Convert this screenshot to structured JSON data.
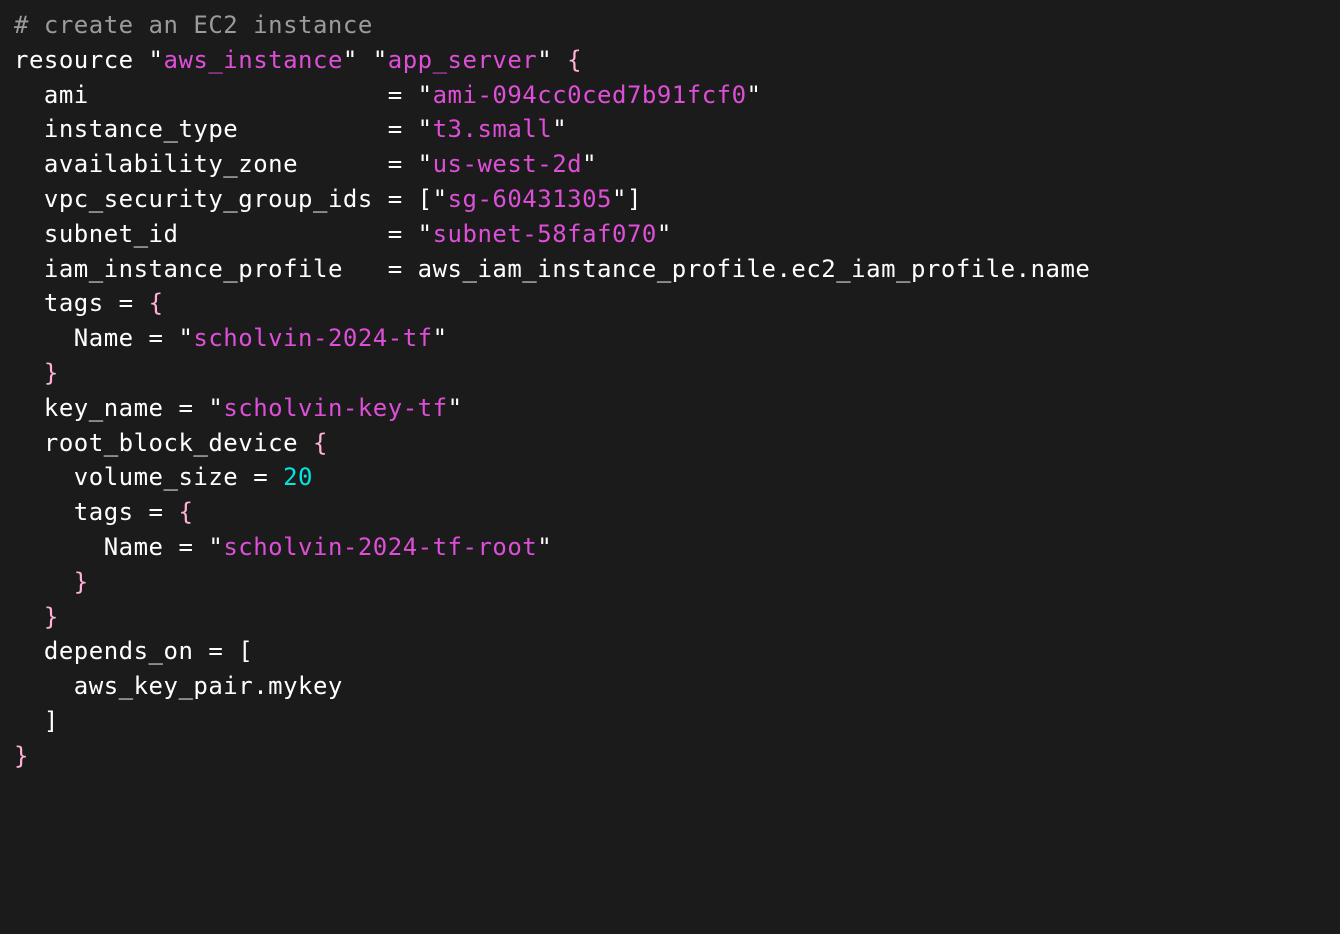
{
  "lines": {
    "l1": "# create an EC2 instance",
    "l2_kw": "resource",
    "l2_q1": "\"",
    "l2_type": "aws_instance",
    "l2_q2": "\"",
    "l2_sp": " ",
    "l2_q3": "\"",
    "l2_name": "app_server",
    "l2_q4": "\"",
    "l2_sp2": " ",
    "l2_ob": "{",
    "l3_pad": "  ",
    "l3_attr": "ami",
    "l3_pad2": "                    ",
    "l3_eq": "=",
    "l3_sp": " ",
    "l3_q1": "\"",
    "l3_val": "ami-094cc0ced7b91fcf0",
    "l3_q2": "\"",
    "l4_pad": "  ",
    "l4_attr": "instance_type",
    "l4_pad2": "          ",
    "l4_eq": "=",
    "l4_sp": " ",
    "l4_q1": "\"",
    "l4_val": "t3.small",
    "l4_q2": "\"",
    "l5_pad": "  ",
    "l5_attr": "availability_zone",
    "l5_pad2": "      ",
    "l5_eq": "=",
    "l5_sp": " ",
    "l5_q1": "\"",
    "l5_val": "us-west-2d",
    "l5_q2": "\"",
    "l6_pad": "  ",
    "l6_attr": "vpc_security_group_ids",
    "l6_pad2": " ",
    "l6_eq": "=",
    "l6_sp": " ",
    "l6_lb": "[",
    "l6_q1": "\"",
    "l6_val": "sg-60431305",
    "l6_q2": "\"",
    "l6_rb": "]",
    "l7_pad": "  ",
    "l7_attr": "subnet_id",
    "l7_pad2": "              ",
    "l7_eq": "=",
    "l7_sp": " ",
    "l7_q1": "\"",
    "l7_val": "subnet-58faf070",
    "l7_q2": "\"",
    "l8_pad": "  ",
    "l8_attr": "iam_instance_profile",
    "l8_pad2": "   ",
    "l8_eq": "=",
    "l8_sp": " ",
    "l8_val": "aws_iam_instance_profile.ec2_iam_profile.name",
    "l9_pad": "  ",
    "l9_attr": "tags",
    "l9_sp": " ",
    "l9_eq": "=",
    "l9_sp2": " ",
    "l9_ob": "{",
    "l10_pad": "    ",
    "l10_attr": "Name",
    "l10_sp": " ",
    "l10_eq": "=",
    "l10_sp2": " ",
    "l10_q1": "\"",
    "l10_val": "scholvin-2024-tf",
    "l10_q2": "\"",
    "l11_pad": "  ",
    "l11_cb": "}",
    "l12_pad": "  ",
    "l12_attr": "key_name",
    "l12_sp": " ",
    "l12_eq": "=",
    "l12_sp2": " ",
    "l12_q1": "\"",
    "l12_val": "scholvin-key-tf",
    "l12_q2": "\"",
    "l13_pad": "  ",
    "l13_attr": "root_block_device",
    "l13_sp": " ",
    "l13_ob": "{",
    "l14_pad": "    ",
    "l14_attr": "volume_size",
    "l14_sp": " ",
    "l14_eq": "=",
    "l14_sp2": " ",
    "l14_val": "20",
    "l15_pad": "    ",
    "l15_attr": "tags",
    "l15_sp": " ",
    "l15_eq": "=",
    "l15_sp2": " ",
    "l15_ob": "{",
    "l16_pad": "      ",
    "l16_attr": "Name",
    "l16_sp": " ",
    "l16_eq": "=",
    "l16_sp2": " ",
    "l16_q1": "\"",
    "l16_val": "scholvin-2024-tf-root",
    "l16_q2": "\"",
    "l17_pad": "    ",
    "l17_cb": "}",
    "l18_pad": "  ",
    "l18_cb": "}",
    "l19_pad": "  ",
    "l19_attr": "depends_on",
    "l19_sp": " ",
    "l19_eq": "=",
    "l19_sp2": " ",
    "l19_lb": "[",
    "l20_pad": "    ",
    "l20_val": "aws_key_pair.mykey",
    "l21_pad": "  ",
    "l21_rb": "]",
    "l22_cb": "}"
  }
}
